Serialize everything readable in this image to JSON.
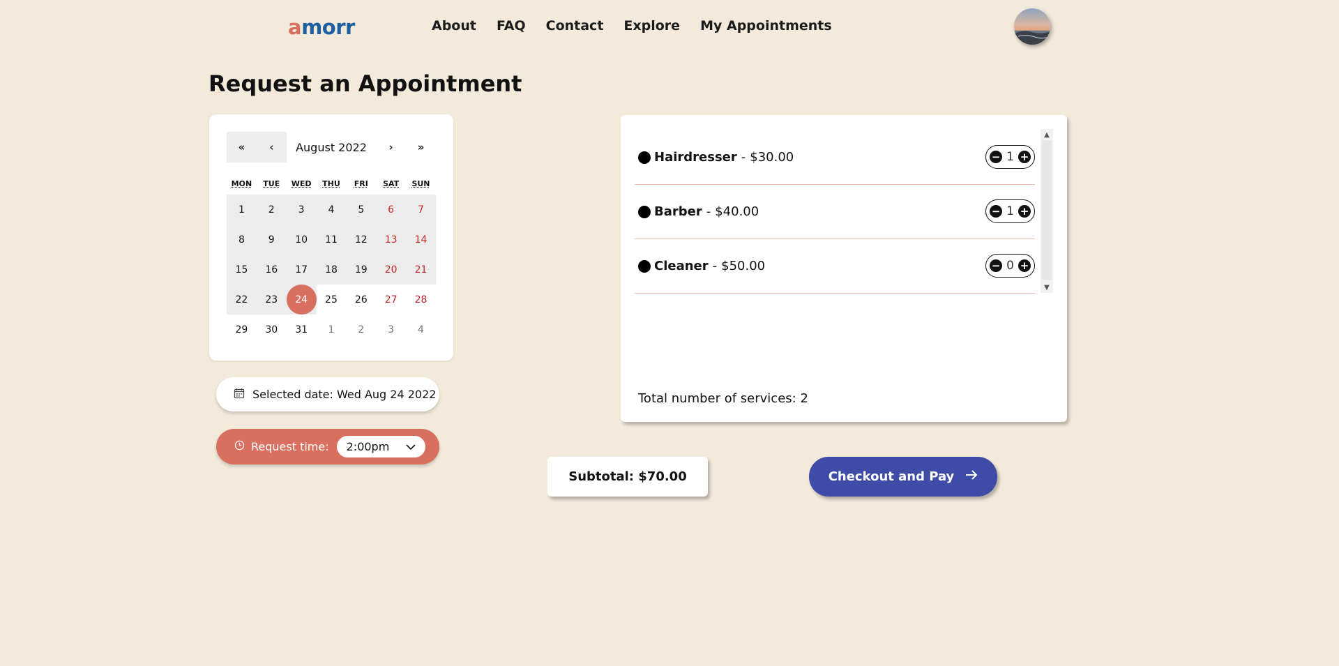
{
  "header": {
    "logo_first": "a",
    "logo_rest": "morr",
    "nav": [
      "About",
      "FAQ",
      "Contact",
      "Explore",
      "My Appointments"
    ]
  },
  "page_title": "Request an Appointment",
  "calendar": {
    "prev_year": "«",
    "prev_month": "‹",
    "month_label": "August 2022",
    "next_month": "›",
    "next_year": "»",
    "weekdays": [
      "MON",
      "TUE",
      "WED",
      "THU",
      "FRI",
      "SAT",
      "SUN"
    ],
    "days": [
      {
        "d": "1",
        "t": "cur"
      },
      {
        "d": "2",
        "t": "cur"
      },
      {
        "d": "3",
        "t": "cur"
      },
      {
        "d": "4",
        "t": "cur"
      },
      {
        "d": "5",
        "t": "cur"
      },
      {
        "d": "6",
        "t": "wkd"
      },
      {
        "d": "7",
        "t": "wkd"
      },
      {
        "d": "8",
        "t": "cur"
      },
      {
        "d": "9",
        "t": "cur"
      },
      {
        "d": "10",
        "t": "cur"
      },
      {
        "d": "11",
        "t": "cur"
      },
      {
        "d": "12",
        "t": "cur"
      },
      {
        "d": "13",
        "t": "wkd"
      },
      {
        "d": "14",
        "t": "wkd"
      },
      {
        "d": "15",
        "t": "cur"
      },
      {
        "d": "16",
        "t": "cur"
      },
      {
        "d": "17",
        "t": "cur"
      },
      {
        "d": "18",
        "t": "cur"
      },
      {
        "d": "19",
        "t": "cur"
      },
      {
        "d": "20",
        "t": "wkd"
      },
      {
        "d": "21",
        "t": "wkd"
      },
      {
        "d": "22",
        "t": "past"
      },
      {
        "d": "23",
        "t": "past"
      },
      {
        "d": "24",
        "t": "sel"
      },
      {
        "d": "25",
        "t": "future"
      },
      {
        "d": "26",
        "t": "future"
      },
      {
        "d": "27",
        "t": "futurewkd"
      },
      {
        "d": "28",
        "t": "futurewkd"
      },
      {
        "d": "29",
        "t": "future"
      },
      {
        "d": "30",
        "t": "future"
      },
      {
        "d": "31",
        "t": "future"
      },
      {
        "d": "1",
        "t": "next"
      },
      {
        "d": "2",
        "t": "next"
      },
      {
        "d": "3",
        "t": "next"
      },
      {
        "d": "4",
        "t": "next"
      }
    ]
  },
  "selected_date": "Selected date: Wed Aug 24 2022",
  "request_time": {
    "label": "Request time:",
    "value": "2:00pm"
  },
  "services": [
    {
      "name": "Hairdresser",
      "sep": "-",
      "price": "$30.00",
      "qty": "1"
    },
    {
      "name": "Barber",
      "sep": "-",
      "price": "$40.00",
      "qty": "1"
    },
    {
      "name": "Cleaner",
      "sep": "-",
      "price": "$50.00",
      "qty": "0"
    }
  ],
  "total_services": "Total number of services: 2",
  "subtotal": "Subtotal: $70.00",
  "checkout_label": "Checkout and Pay",
  "colors": {
    "background": "#f3eadb",
    "accent": "#d9705f",
    "brand_blue": "#1d5fa0",
    "checkout": "#3e4ba7",
    "weekend": "#c62828"
  },
  "icons": {
    "calendar": "calendar-icon",
    "clock": "clock-icon",
    "arrow": "arrow-right-icon",
    "chevron": "chevron-down-icon"
  }
}
